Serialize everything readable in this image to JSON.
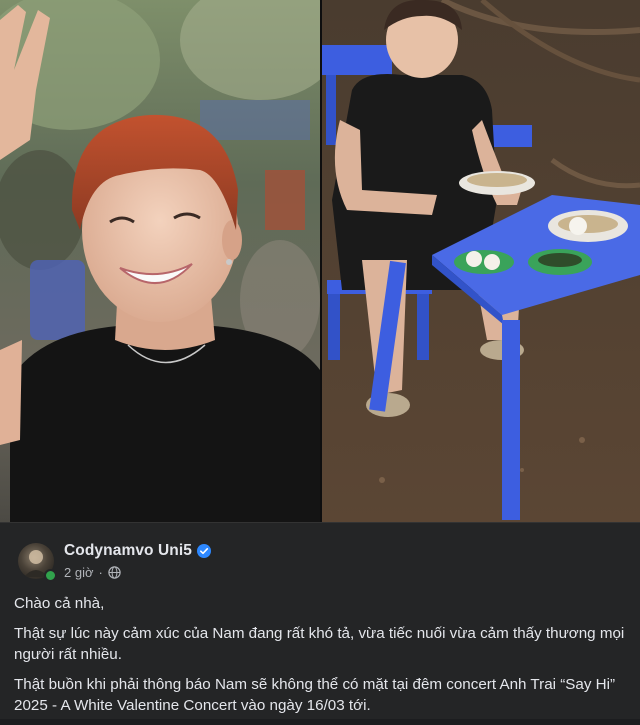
{
  "post": {
    "author": "Codynamvo Uni5",
    "verified": true,
    "time": "2 giờ",
    "privacy_icon": "globe-icon",
    "paragraphs": [
      "Chào cả nhà,",
      "Thật sự lúc này cảm xúc của Nam đang rất khó tả, vừa tiếc nuối vừa cảm thấy thương mọi người rất nhiều.",
      "Thật buồn khi phải thông báo Nam sẽ không thể có mặt tại đêm concert Anh Trai “Say Hi” 2025 - A White Valentine Concert vào ngày 16/03 tới."
    ]
  },
  "photos": [
    {
      "name": "selfie-photo"
    },
    {
      "name": "outdoor-table-photo"
    }
  ],
  "colors": {
    "background": "#242526",
    "text": "#e4e6eb",
    "muted": "#b0b3b8",
    "verified": "#2d88ff",
    "online": "#31a24c",
    "stool_blue": "#3d5ee0"
  }
}
